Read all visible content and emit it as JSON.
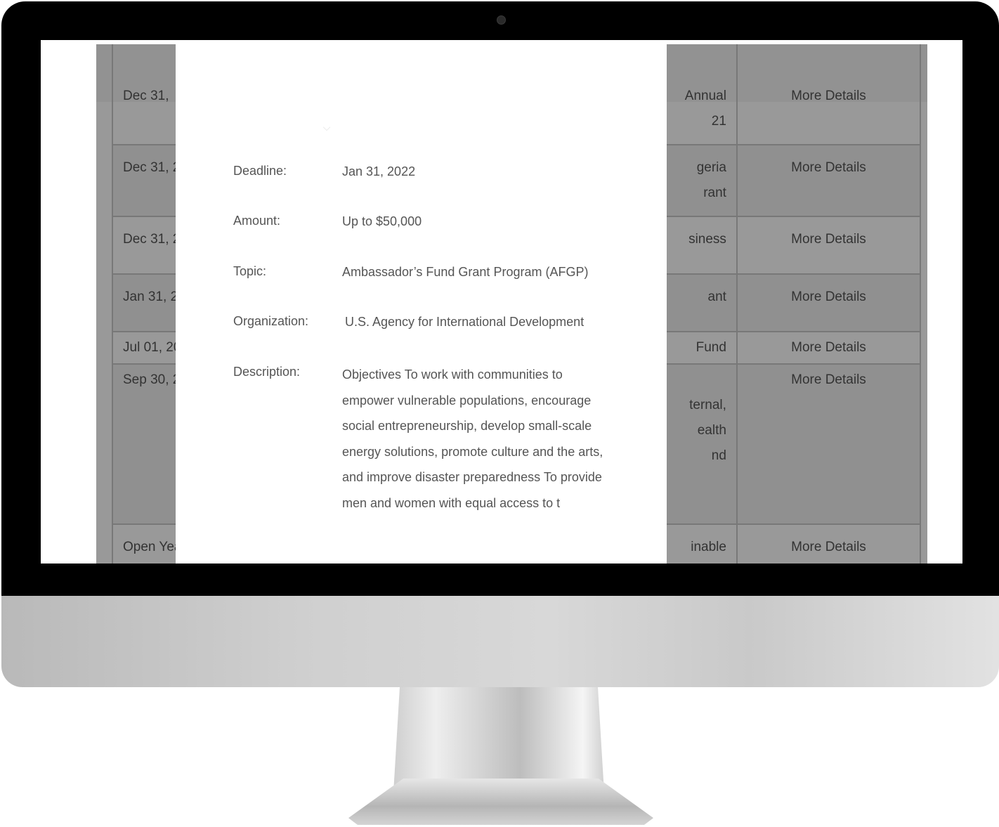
{
  "modal": {
    "fields": [
      {
        "label": "Deadline:",
        "value": "Jan 31, 2022"
      },
      {
        "label": "Amount:",
        "value": "Up to $50,000"
      },
      {
        "label": "Topic:",
        "value": "Ambassador’s Fund Grant Program (AFGP)"
      },
      {
        "label": "Organization:",
        "value": "U.S. Agency for International Development"
      },
      {
        "label": "Description:",
        "value": "Objectives To work with communities to empower vulnerable populations, encourage social entrepreneurship, develop small-scale energy solutions, promote culture and the arts, and improve disaster preparedness To provide men and women with equal access to t"
      }
    ]
  },
  "table": {
    "rows": [
      {
        "date": "Dec 31, ",
        "title": "Annual\n21",
        "link": "More Details"
      },
      {
        "date": "Dec 31, 2",
        "title": "geria\nrant",
        "link": "More Details"
      },
      {
        "date": "Dec 31, 2",
        "title": "siness",
        "link": "More Details"
      },
      {
        "date": "Jan 31, 2",
        "title": "ant",
        "link": "More Details"
      },
      {
        "date": "Jul 01, 20",
        "title": "Fund",
        "link": "More Details"
      },
      {
        "date": "Sep 30, 2",
        "title": "\nternal,\nealth\nnd",
        "link": "More Details"
      },
      {
        "date": "Open Yea",
        "title": "inable",
        "link": "More Details"
      }
    ]
  }
}
